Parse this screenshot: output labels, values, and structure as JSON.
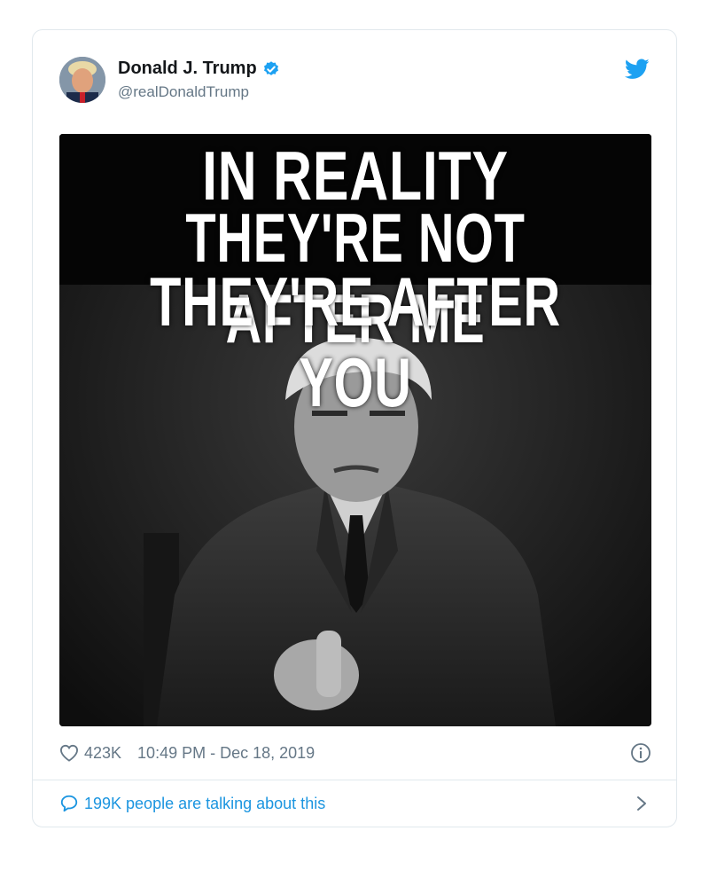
{
  "tweet": {
    "display_name": "Donald J. Trump",
    "handle": "@realDonaldTrump",
    "verified": true,
    "image_caption": {
      "line1": "IN REALITY",
      "line2": "THEY'RE NOT AFTER ME",
      "line3": "THEY'RE AFTER YOU"
    },
    "likes": "423K",
    "timestamp": "10:49 PM - Dec 18, 2019",
    "talking": "199K people are talking about this"
  },
  "colors": {
    "twitter_blue": "#1da1f2",
    "link_blue": "#1b95e0",
    "text_dark": "#14171a",
    "text_gray": "#657786",
    "border": "#e1e8ed"
  },
  "icons": [
    "heart-icon",
    "info-icon",
    "speech-bubble-icon",
    "chevron-right-icon",
    "twitter-bird-icon",
    "verified-badge-icon"
  ]
}
